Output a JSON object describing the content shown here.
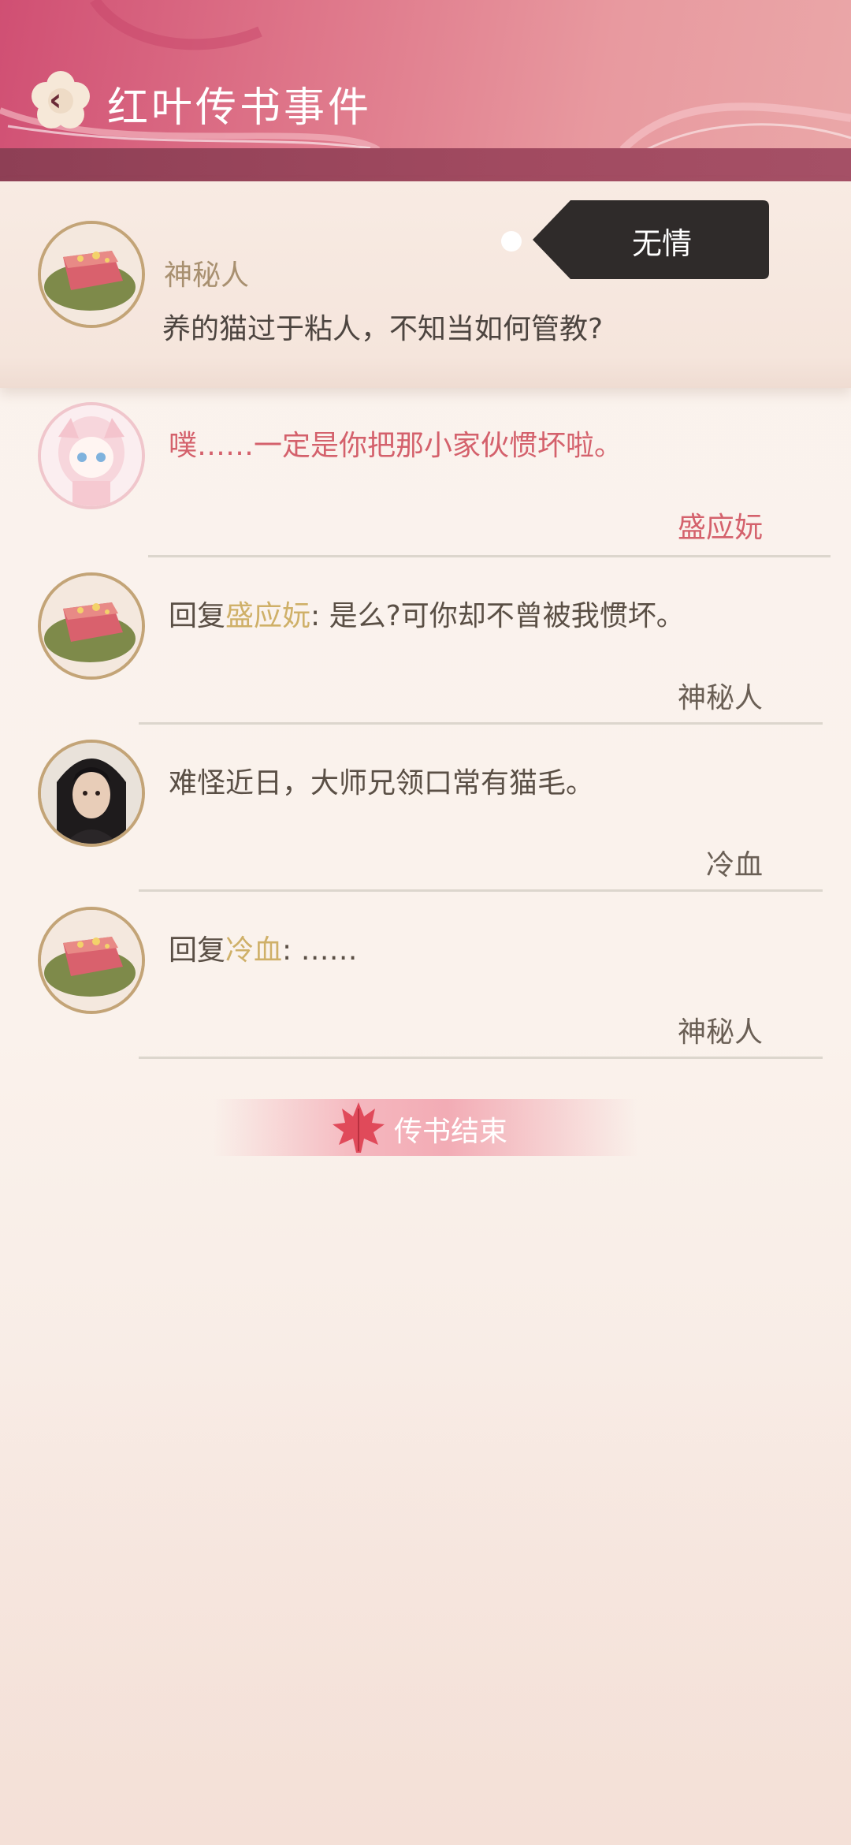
{
  "header": {
    "title": "红叶传书事件",
    "back_icon": "chevron-left-icon"
  },
  "post": {
    "author": "神秘人",
    "text": "养的猫过于粘人，不知当如何管教?",
    "tag": "无情"
  },
  "replies": [
    {
      "text": "噗……一定是你把那小家伙惯坏啦。",
      "author": "盛应妧"
    },
    {
      "prefix": "回复",
      "target": "盛应妧",
      "sep": ":",
      "text": " 是么?可你却不曾被我惯坏。",
      "author": "神秘人"
    },
    {
      "text": "难怪近日，大师兄领口常有猫毛。",
      "author": "冷血"
    },
    {
      "prefix": "回复",
      "target": "冷血",
      "sep": ":",
      "text": " ……",
      "author": "神秘人"
    }
  ],
  "end_banner": {
    "label": "传书结束",
    "icon": "maple-leaf-icon"
  },
  "colors": {
    "accent": "#d04f73",
    "reply_target": "#cfb068",
    "pink_text": "#d4616c"
  }
}
